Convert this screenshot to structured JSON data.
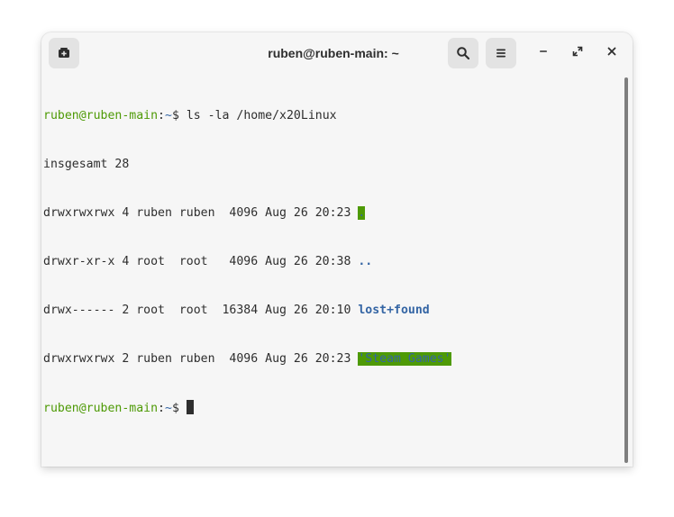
{
  "window": {
    "title": "ruben@ruben-main: ~"
  },
  "headerbar": {
    "new_tab_icon": "new-tab-icon",
    "search_icon": "search-icon",
    "menu_icon": "hamburger-menu-icon",
    "minimize_icon": "minimize-icon",
    "maximize_icon": "maximize-icon",
    "close_icon": "close-icon"
  },
  "terminal": {
    "prompt_user": "ruben@ruben-main",
    "prompt_sep": ":",
    "prompt_path": "~",
    "prompt_dollar": "$ ",
    "command": "ls -la /home/x20Linux",
    "total_line": "insgesamt 28",
    "rows": [
      {
        "meta": "drwxrwxrwx 4 ruben ruben  4096 Aug 26 20:23 ",
        "name": "."
      },
      {
        "meta": "drwxr-xr-x 4 root  root   4096 Aug 26 20:38 ",
        "name": ".."
      },
      {
        "meta": "drwx------ 2 root  root  16384 Aug 26 20:10 ",
        "name": "lost+found"
      },
      {
        "meta": "drwxrwxrwx 2 ruben ruben  4096 Aug 26 20:23 ",
        "name": "'Steam Games'"
      }
    ]
  },
  "colors": {
    "prompt_green": "#4e9a06",
    "dir_blue": "#3465a4",
    "background": "#f6f6f6"
  }
}
